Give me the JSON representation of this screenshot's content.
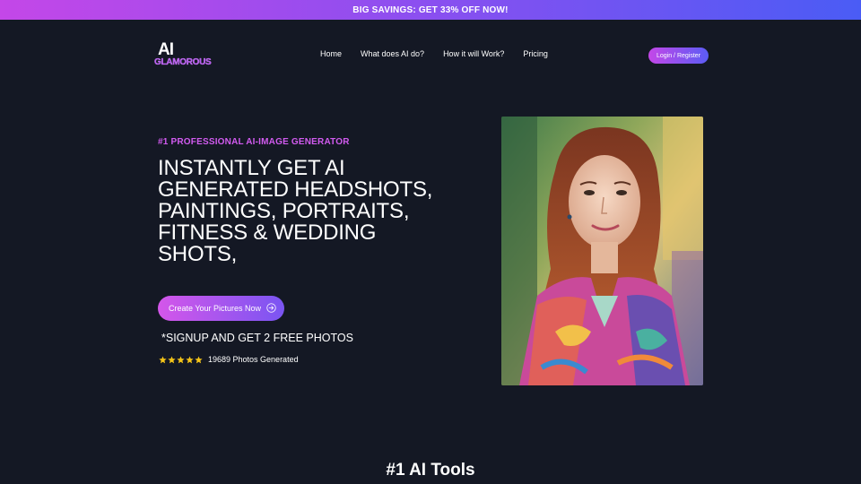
{
  "promo": {
    "text": "BIG SAVINGS: GET 33% OFF NOW!"
  },
  "logo": {
    "mark": "AI",
    "wordmark": "GLAMOROUS"
  },
  "nav": {
    "links": [
      "Home",
      "What does AI do?",
      "How it will Work?",
      "Pricing"
    ],
    "login_label": "Login / Register"
  },
  "hero": {
    "eyebrow": "#1 PROFESSIONAL AI-IMAGE GENERATOR",
    "title": "INSTANTLY GET AI GENERATED HEADSHOTS, PAINTINGS, PORTRAITS, FITNESS & WEDDING SHOTS,",
    "cta_label": "Create Your Pictures Now",
    "signup_note": "*SIGNUP AND GET 2 FREE PHOTOS",
    "rating_stars": 5,
    "photos_generated": "19689 Photos Generated"
  },
  "section": {
    "title": "#1 AI Tools"
  },
  "colors": {
    "background": "#141824",
    "accent_pink": "#d25bf0",
    "accent_blue": "#4a5cf5",
    "star": "#f5c518"
  },
  "icons": [
    "arrow-right-circle-icon",
    "star-icon"
  ]
}
